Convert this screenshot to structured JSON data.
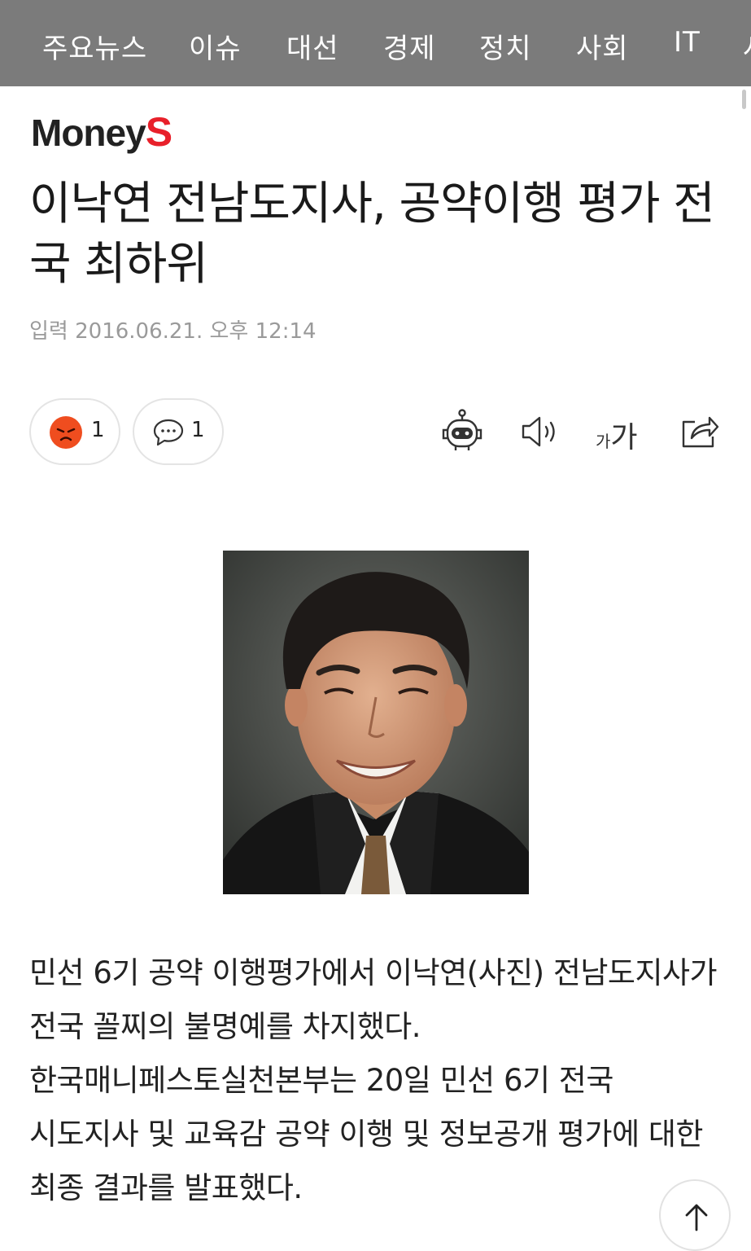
{
  "nav": {
    "items": [
      "주요뉴스",
      "이슈",
      "대선",
      "경제",
      "정치",
      "사회",
      "IT",
      "사"
    ]
  },
  "brand": {
    "logo_main": "Money",
    "logo_accent": "S",
    "accent_color": "#e8202a"
  },
  "article": {
    "title": "이낙연 전남도지사, 공약이행 평가 전국 최하위",
    "date_label": "입력",
    "date": "2016.06.21. 오후 12:14",
    "body": "민선 6기 공약 이행평가에서 이낙연(사진) 전남도지사가 전국 꼴찌의 불명예를 차지했다. 한국매니페스토실천본부는 20일 민선 6기 전국 시도지사 및 교육감 공약 이행 및 정보공개 평가에 대한 최종 결과를 발표했다."
  },
  "actions": {
    "reaction_count": "1",
    "comment_count": "1",
    "fontsize_small": "가",
    "fontsize_big": "가"
  },
  "icons": {
    "reaction": "angry-face-icon",
    "comment": "speech-bubble-icon",
    "summary": "robot-icon",
    "tts": "speaker-icon",
    "share": "share-icon",
    "top": "arrow-up-icon"
  }
}
